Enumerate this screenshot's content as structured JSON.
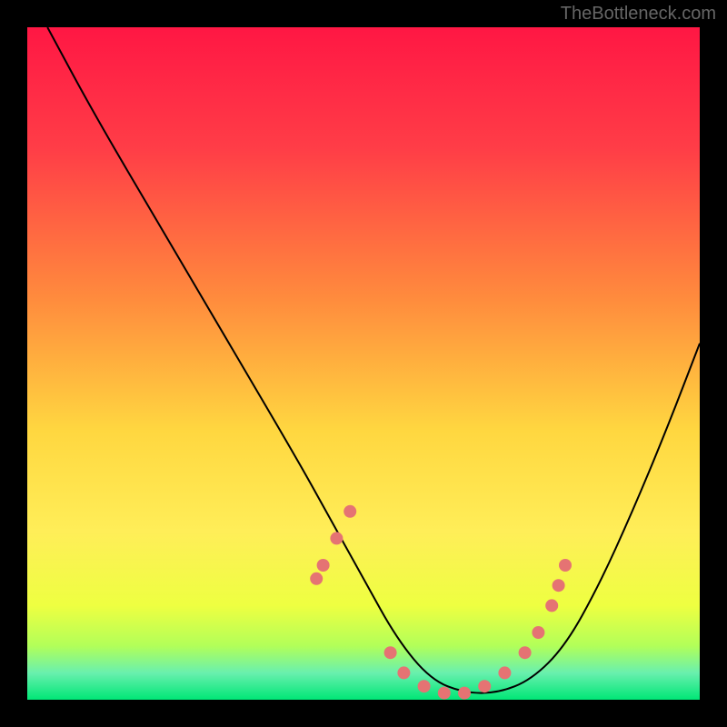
{
  "watermark": "TheBottleneck.com",
  "chart_data": {
    "type": "line",
    "title": "",
    "xlabel": "",
    "ylabel": "",
    "xlim": [
      0,
      100
    ],
    "ylim": [
      0,
      100
    ],
    "series": [
      {
        "name": "curve",
        "x": [
          3,
          10,
          20,
          30,
          40,
          45,
          50,
          55,
          60,
          65,
          70,
          75,
          80,
          85,
          90,
          95,
          100
        ],
        "values": [
          100,
          87,
          70,
          53,
          36,
          27,
          18,
          9,
          3,
          1,
          1,
          3,
          8,
          17,
          28,
          40,
          53
        ]
      }
    ],
    "dots": [
      {
        "x": 43,
        "y": 82
      },
      {
        "x": 44,
        "y": 80
      },
      {
        "x": 46,
        "y": 76
      },
      {
        "x": 48,
        "y": 72
      },
      {
        "x": 54,
        "y": 93
      },
      {
        "x": 56,
        "y": 96
      },
      {
        "x": 59,
        "y": 98
      },
      {
        "x": 62,
        "y": 99
      },
      {
        "x": 65,
        "y": 99
      },
      {
        "x": 68,
        "y": 98
      },
      {
        "x": 71,
        "y": 96
      },
      {
        "x": 74,
        "y": 93
      },
      {
        "x": 76,
        "y": 90
      },
      {
        "x": 78,
        "y": 86
      },
      {
        "x": 79,
        "y": 83
      },
      {
        "x": 80,
        "y": 80
      }
    ],
    "gradient_stops": [
      {
        "offset": 0,
        "color": "#ff1744"
      },
      {
        "offset": 18,
        "color": "#ff3d47"
      },
      {
        "offset": 40,
        "color": "#ff8a3d"
      },
      {
        "offset": 60,
        "color": "#ffd740"
      },
      {
        "offset": 75,
        "color": "#ffee58"
      },
      {
        "offset": 86,
        "color": "#eeff41"
      },
      {
        "offset": 92,
        "color": "#b2ff59"
      },
      {
        "offset": 96,
        "color": "#69f0ae"
      },
      {
        "offset": 100,
        "color": "#00e676"
      }
    ]
  }
}
